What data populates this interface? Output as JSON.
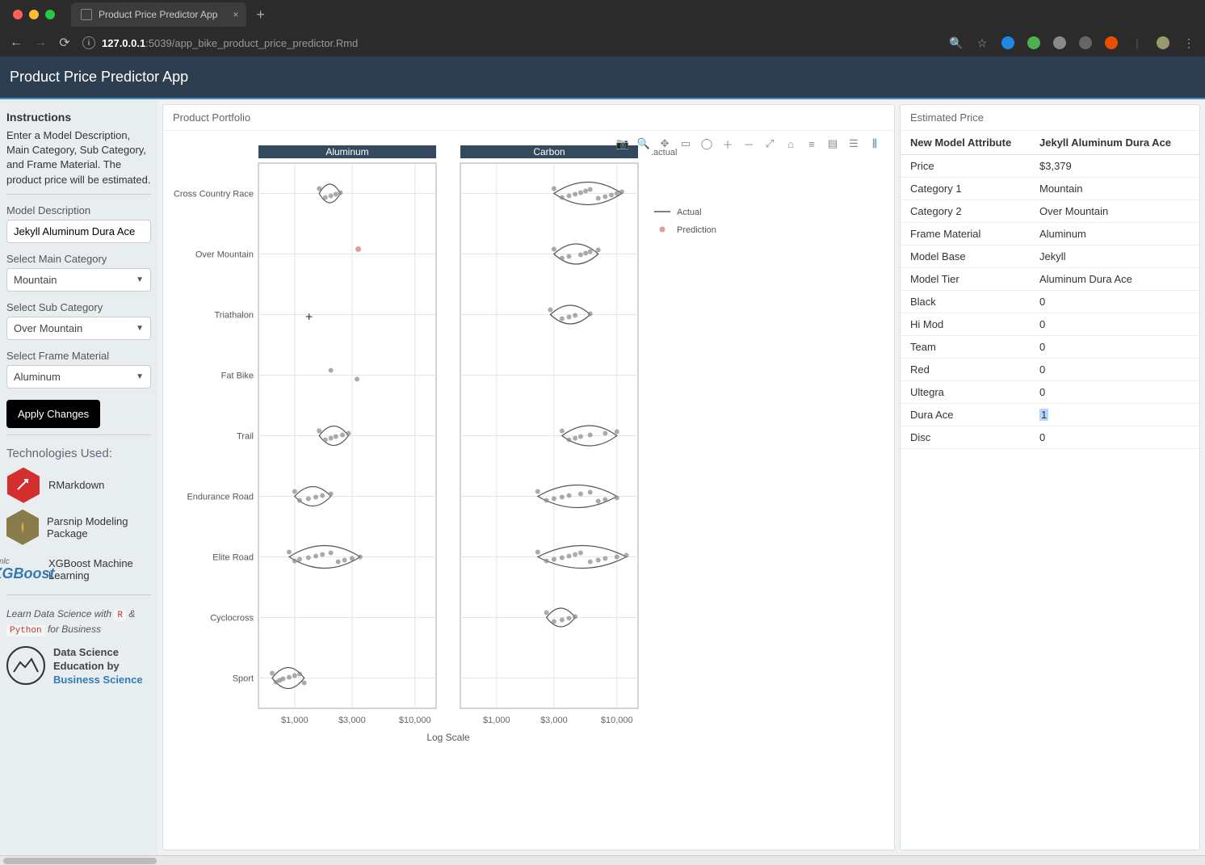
{
  "browser": {
    "tab_title": "Product Price Predictor App",
    "url_host": "127.0.0.1",
    "url_path": ":5039/app_bike_product_price_predictor.Rmd"
  },
  "header": {
    "title": "Product Price Predictor App"
  },
  "sidebar": {
    "instructions_title": "Instructions",
    "instructions_text": "Enter a Model Description, Main Category, Sub Category, and Frame Material. The product price will be estimated.",
    "model_desc_label": "Model Description",
    "model_desc_value": "Jekyll Aluminum Dura Ace",
    "main_cat_label": "Select Main Category",
    "main_cat_value": "Mountain",
    "sub_cat_label": "Select Sub Category",
    "sub_cat_value": "Over Mountain",
    "frame_label": "Select Frame Material",
    "frame_value": "Aluminum",
    "apply_label": "Apply Changes",
    "tech_title": "Technologies Used:",
    "tech1": "RMarkdown",
    "tech2": "Parsnip Modeling Package",
    "tech3": "XGBoost Machine Learning",
    "learn_prefix": "Learn Data Science with ",
    "learn_r": "R",
    "learn_amp": " & ",
    "learn_py": "Python",
    "learn_suffix": " for Business",
    "bs_line1": "Data Science",
    "bs_line2": "Education by",
    "bs_link": "Business Science"
  },
  "chart": {
    "panel_title": "Product Portfolio",
    "facet1": "Aluminum",
    "facet2": "Carbon",
    "corner_label": ".actual",
    "xaxis_title": "Log Scale",
    "legend": {
      "actual": "Actual",
      "prediction": "Prediction"
    },
    "categories": [
      "Cross Country Race",
      "Over Mountain",
      "Triathalon",
      "Fat Bike",
      "Trail",
      "Endurance Road",
      "Elite Road",
      "Cyclocross",
      "Sport"
    ],
    "x_ticks": [
      "$1,000",
      "$3,000",
      "$10,000"
    ]
  },
  "chart_data": {
    "type": "scatter",
    "note": "Violin+jitter plot faceted by frame material; x is price (log scale), y is bike category. Values are approximate readings.",
    "x_ticks": [
      1000,
      3000,
      10000
    ],
    "facets": [
      "Aluminum",
      "Carbon"
    ],
    "categories": [
      "Cross Country Race",
      "Over Mountain",
      "Triathalon",
      "Fat Bike",
      "Trail",
      "Endurance Road",
      "Elite Road",
      "Cyclocross",
      "Sport"
    ],
    "prediction": {
      "facet": "Aluminum",
      "category": "Over Mountain",
      "price": 3379
    },
    "series": [
      {
        "facet": "Aluminum",
        "category": "Cross Country Race",
        "prices": [
          1600,
          1800,
          2000,
          2200,
          2400
        ]
      },
      {
        "facet": "Aluminum",
        "category": "Over Mountain",
        "prices": []
      },
      {
        "facet": "Aluminum",
        "category": "Triathalon",
        "prices": []
      },
      {
        "facet": "Aluminum",
        "category": "Fat Bike",
        "prices": [
          2000,
          3300
        ]
      },
      {
        "facet": "Aluminum",
        "category": "Trail",
        "prices": [
          1600,
          1800,
          2000,
          2200,
          2500,
          2800
        ]
      },
      {
        "facet": "Aluminum",
        "category": "Endurance Road",
        "prices": [
          1000,
          1100,
          1300,
          1500,
          1700,
          2000
        ]
      },
      {
        "facet": "Aluminum",
        "category": "Elite Road",
        "prices": [
          900,
          1000,
          1100,
          1300,
          1500,
          1700,
          2000,
          2300,
          2600,
          3000,
          3500
        ]
      },
      {
        "facet": "Aluminum",
        "category": "Cyclocross",
        "prices": []
      },
      {
        "facet": "Aluminum",
        "category": "Sport",
        "prices": [
          650,
          700,
          750,
          800,
          900,
          1000,
          1100,
          1200
        ]
      },
      {
        "facet": "Carbon",
        "category": "Cross Country Race",
        "prices": [
          3000,
          3500,
          4000,
          4500,
          5000,
          5500,
          6000,
          7000,
          8000,
          9000,
          10000,
          11000
        ]
      },
      {
        "facet": "Carbon",
        "category": "Over Mountain",
        "prices": [
          3000,
          3500,
          4000,
          5000,
          5500,
          6000,
          7000
        ]
      },
      {
        "facet": "Carbon",
        "category": "Triathalon",
        "prices": [
          2800,
          3500,
          4000,
          4500,
          6000
        ]
      },
      {
        "facet": "Carbon",
        "category": "Fat Bike",
        "prices": []
      },
      {
        "facet": "Carbon",
        "category": "Trail",
        "prices": [
          3500,
          4000,
          4500,
          5000,
          6000,
          8000,
          10000
        ]
      },
      {
        "facet": "Carbon",
        "category": "Endurance Road",
        "prices": [
          2200,
          2600,
          3000,
          3500,
          4000,
          5000,
          6000,
          7000,
          8000,
          10000
        ]
      },
      {
        "facet": "Carbon",
        "category": "Elite Road",
        "prices": [
          2200,
          2600,
          3000,
          3500,
          4000,
          4500,
          5000,
          6000,
          7000,
          8000,
          10000,
          12000
        ]
      },
      {
        "facet": "Carbon",
        "category": "Cyclocross",
        "prices": [
          2600,
          3000,
          3500,
          4000,
          4500
        ]
      },
      {
        "facet": "Carbon",
        "category": "Sport",
        "prices": []
      }
    ]
  },
  "estimate": {
    "panel_title": "Estimated Price",
    "header1": "New Model Attribute",
    "header2": "Jekyll Aluminum Dura Ace",
    "rows": [
      {
        "k": "Price",
        "v": "$3,379"
      },
      {
        "k": "Category 1",
        "v": "Mountain"
      },
      {
        "k": "Category 2",
        "v": "Over Mountain"
      },
      {
        "k": "Frame Material",
        "v": "Aluminum"
      },
      {
        "k": "Model Base",
        "v": "Jekyll"
      },
      {
        "k": "Model Tier",
        "v": "Aluminum Dura Ace"
      },
      {
        "k": "Black",
        "v": "0"
      },
      {
        "k": "Hi Mod",
        "v": "0"
      },
      {
        "k": "Team",
        "v": "0"
      },
      {
        "k": "Red",
        "v": "0"
      },
      {
        "k": "Ultegra",
        "v": "0"
      },
      {
        "k": "Dura Ace",
        "v": "1",
        "highlight": true
      },
      {
        "k": "Disc",
        "v": "0"
      }
    ]
  }
}
